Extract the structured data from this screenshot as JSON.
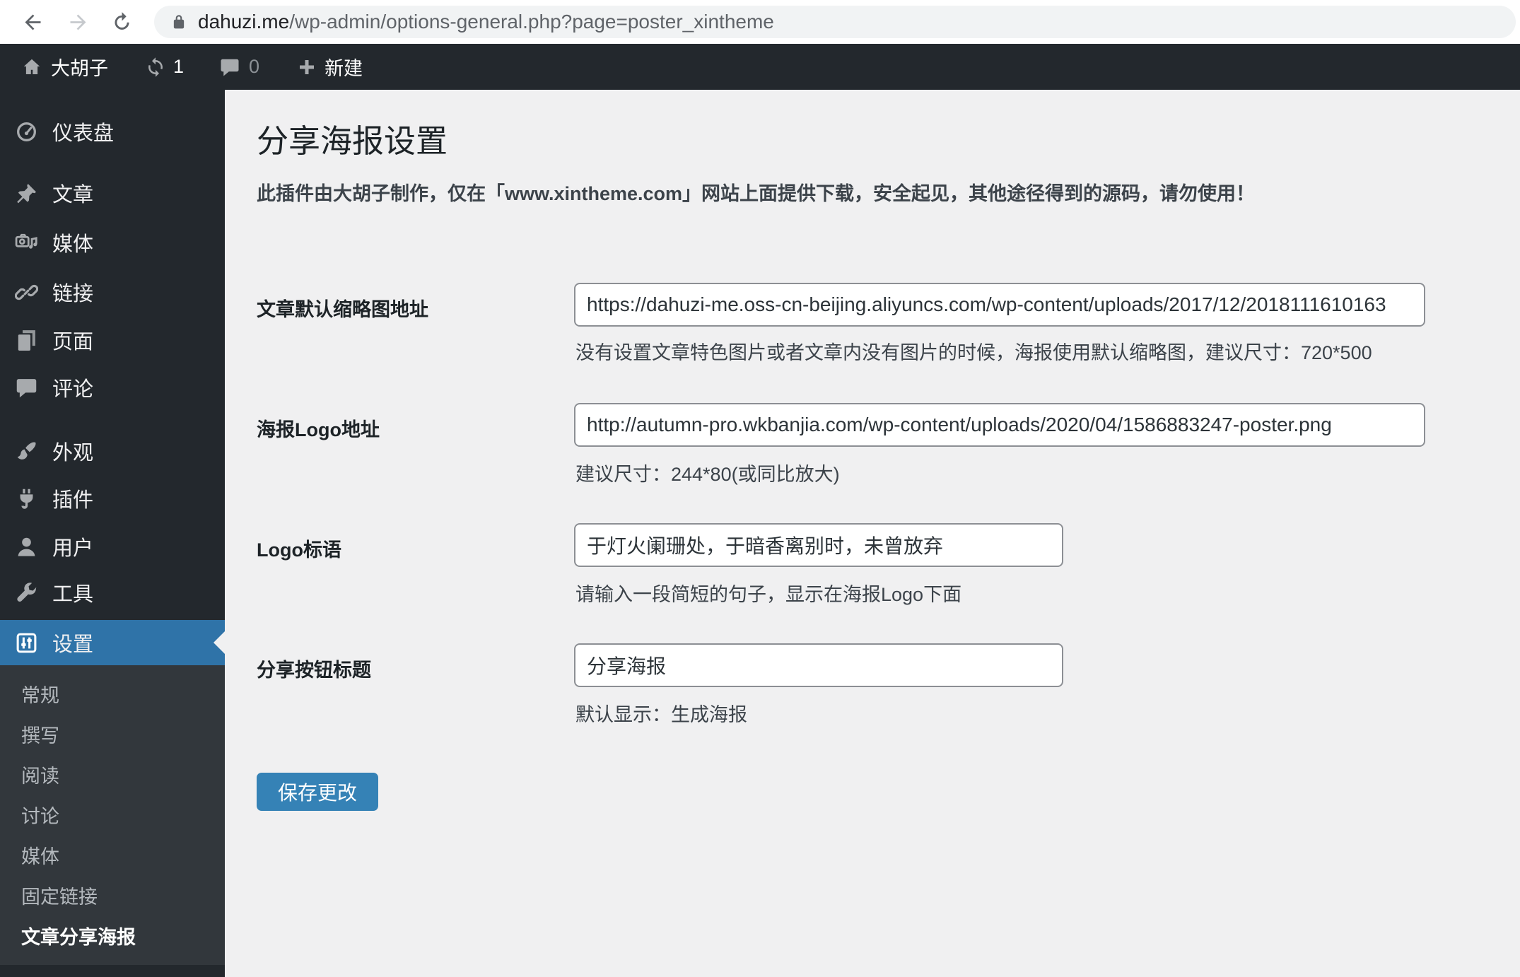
{
  "browser": {
    "url_host": "dahuzi.me",
    "url_path": "/wp-admin/options-general.php?page=poster_xintheme"
  },
  "admin_bar": {
    "site_name": "大胡子",
    "update_count": "1",
    "comment_count": "0",
    "new_label": "新建",
    "icons": [
      "home-icon",
      "update-icon",
      "comment-icon",
      "plus-icon"
    ]
  },
  "sidebar": {
    "items": [
      {
        "label": "仪表盘",
        "icon": "dashboard-icon"
      },
      {
        "label": "文章",
        "icon": "pushpin-icon"
      },
      {
        "label": "媒体",
        "icon": "media-icon"
      },
      {
        "label": "链接",
        "icon": "link-icon"
      },
      {
        "label": "页面",
        "icon": "pages-icon"
      },
      {
        "label": "评论",
        "icon": "comment-icon"
      },
      {
        "label": "外观",
        "icon": "brush-icon"
      },
      {
        "label": "插件",
        "icon": "plug-icon"
      },
      {
        "label": "用户",
        "icon": "user-icon"
      },
      {
        "label": "工具",
        "icon": "wrench-icon"
      },
      {
        "label": "设置",
        "icon": "sliders-icon",
        "active": true
      }
    ],
    "submenu": {
      "items": [
        {
          "label": "常规"
        },
        {
          "label": "撰写"
        },
        {
          "label": "阅读"
        },
        {
          "label": "讨论"
        },
        {
          "label": "媒体"
        },
        {
          "label": "固定链接"
        },
        {
          "label": "文章分享海报",
          "current": true
        }
      ]
    }
  },
  "main": {
    "title": "分享海报设置",
    "notice": "此插件由大胡子制作，仅在「www.xintheme.com」网站上面提供下载，安全起见，其他途径得到的源码，请勿使用！",
    "fields": [
      {
        "label": "文章默认缩略图地址",
        "value": "https://dahuzi-me.oss-cn-beijing.aliyuncs.com/wp-content/uploads/2017/12/2018111610163",
        "helper": "没有设置文章特色图片或者文章内没有图片的时候，海报使用默认缩略图，建议尺寸：720*500"
      },
      {
        "label": "海报Logo地址",
        "value": "http://autumn-pro.wkbanjia.com/wp-content/uploads/2020/04/1586883247-poster.png",
        "helper": "建议尺寸：244*80(或同比放大)"
      },
      {
        "label": "Logo标语",
        "value": "于灯火阑珊处，于暗香离别时，未曾放弃",
        "helper": "请输入一段简短的句子，显示在海报Logo下面"
      },
      {
        "label": "分享按钮标题",
        "value": "分享海报",
        "helper": "默认显示：生成海报"
      }
    ],
    "save_label": "保存更改"
  },
  "colors": {
    "menu_active_bg": "#2f73a8",
    "button_bg": "#3582b6",
    "admin_bar_bg": "#23282d",
    "submenu_bg": "#32373c",
    "content_bg": "#f0f0f1"
  }
}
